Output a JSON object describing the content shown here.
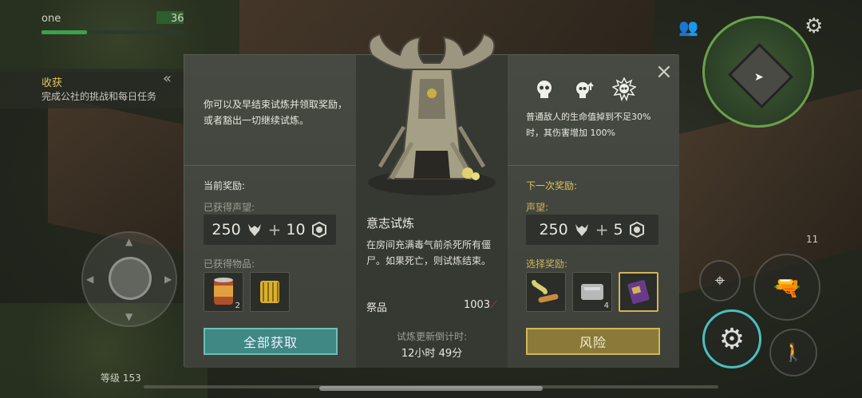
{
  "hud": {
    "player_name": "one",
    "player_value": "36",
    "health_fraction": 0.32,
    "quest_title": "收获",
    "quest_subtitle": "完成公社的挑战和每日任务",
    "level_label": "等级 153",
    "ammo_count": "11"
  },
  "modal": {
    "close_symbol": "×",
    "description": "你可以及早结束试炼并领取奖励，或者豁出一切继续试炼。",
    "current_rewards": {
      "heading": "当前奖励:",
      "reputation_label": "已获得声望:",
      "reputation_value": "250",
      "plus": "+",
      "token_value": "10",
      "items_label": "已获得物品:",
      "items": [
        {
          "name": "canned-food",
          "count": "2"
        },
        {
          "name": "filter",
          "count": ""
        }
      ],
      "collect_button": "全部获取"
    },
    "trial": {
      "name": "意志试炼",
      "description": "在房间充满毒气前杀死所有僵尸。如果死亡，则试炼结束。",
      "offering_label": "祭品",
      "offering_value": "1003",
      "timer_label": "试炼更新倒计时:",
      "timer_value": "12小时 49分"
    },
    "next_rewards": {
      "modifier_text": "普通敌人的生命值掉到不足30% 时，其伤害增加 100%",
      "heading": "下一次奖励:",
      "reputation_label": "声望:",
      "reputation_value": "250",
      "plus": "+",
      "token_value": "5",
      "choose_label": "选择奖励:",
      "items": [
        {
          "name": "dog-bones",
          "count": ""
        },
        {
          "name": "duct-tape",
          "count": "4"
        },
        {
          "name": "purple-book",
          "count": "",
          "selected": true
        }
      ],
      "risk_button": "风险"
    }
  },
  "colors": {
    "accent_teal": "#3f8884",
    "accent_gold": "#d2b25a",
    "health_green": "#3aa24c"
  }
}
